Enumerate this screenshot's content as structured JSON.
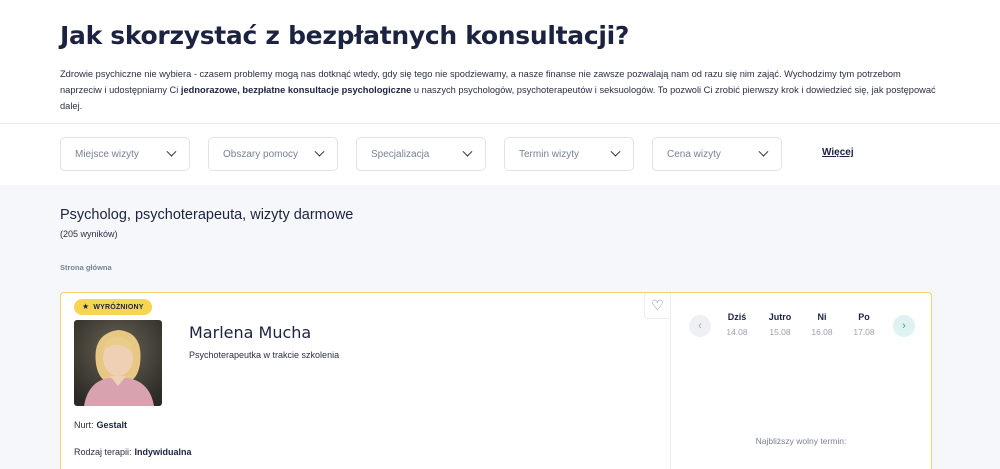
{
  "hero": {
    "title": "Jak skorzystać z bezpłatnych konsultacji?",
    "desc_1": "Zdrowie psychiczne nie wybiera - czasem problemy mogą nas dotknąć wtedy, gdy się tego nie spodziewamy, a nasze finanse nie zawsze pozwalają nam od razu się nim zająć. Wychodzimy tym potrzebom naprzeciw i udostępniamy Ci ",
    "desc_bold": "jednorazowe, bezpłatne konsultacje psychologiczne",
    "desc_2": " u naszych psychologów, psychoterapeutów i seksuologów. To pozwoli Ci zrobić pierwszy krok i dowiedzieć się, jak postępować dalej."
  },
  "filters": {
    "items": [
      {
        "label": "Miejsce wizyty"
      },
      {
        "label": "Obszary pomocy"
      },
      {
        "label": "Specjalizacja"
      },
      {
        "label": "Termin wizyty"
      },
      {
        "label": "Cena wizyty"
      }
    ],
    "more_label": "Więcej"
  },
  "results": {
    "heading": "Psycholog, psychoterapeuta, wizyty darmowe",
    "count": "(205 wyników)",
    "breadcrumb": "Strona główna"
  },
  "card": {
    "badge": "WYRÓŻNIONY",
    "name": "Marlena Mucha",
    "role": "Psychoterapeutka w trakcie szkolenia",
    "nurt_label": "Nurt:",
    "nurt_value": "Gestalt",
    "therapy_label": "Rodzaj terapii:",
    "therapy_value": "Indywidualna",
    "days": [
      {
        "day": "Dziś",
        "date": "14.08"
      },
      {
        "day": "Jutro",
        "date": "15.08"
      },
      {
        "day": "Ni",
        "date": "16.08"
      },
      {
        "day": "Po",
        "date": "17.08"
      }
    ],
    "nearest_label": "Najbliższy wolny termin:"
  },
  "colors": {
    "accent_yellow": "#f7d553",
    "card_border": "#f1d36a",
    "text_dark": "#1c2340",
    "next_button": "#dff2f2"
  }
}
